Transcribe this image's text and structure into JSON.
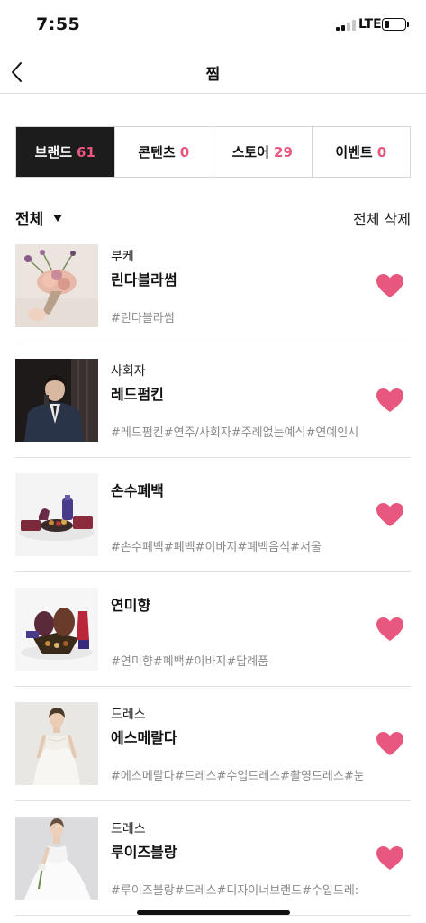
{
  "status_bar": {
    "time": "7:55",
    "network": "LTE"
  },
  "header": {
    "title": "찜"
  },
  "tabs": [
    {
      "label": "브랜드",
      "count": "61",
      "active": true
    },
    {
      "label": "콘텐츠",
      "count": "0",
      "active": false
    },
    {
      "label": "스토어",
      "count": "29",
      "active": false
    },
    {
      "label": "이벤트",
      "count": "0",
      "active": false
    }
  ],
  "filter": {
    "selected": "전체",
    "delete_all": "전체 삭제"
  },
  "items": [
    {
      "category": "부케",
      "name": "린다블라썸",
      "tags": "#린다블라썸",
      "liked": true
    },
    {
      "category": "사회자",
      "name": "레드펌킨",
      "tags": "#레드펌킨#연주/사회자#주례없는예식#연예인시",
      "liked": true
    },
    {
      "category": "",
      "name": "손수폐백",
      "tags": "#손수폐백#폐백#이바지#폐백음식#서울",
      "liked": true
    },
    {
      "category": "",
      "name": "연미향",
      "tags": "#연미향#폐백#이바지#답례품",
      "liked": true
    },
    {
      "category": "드레스",
      "name": "에스메랄다",
      "tags": "#에스메랄다#드레스#수입드레스#촬영드레스#눈",
      "liked": true
    },
    {
      "category": "드레스",
      "name": "루이즈블랑",
      "tags": "#루이즈블랑#드레스#디자이너브랜드#수입드레:",
      "liked": true
    }
  ],
  "colors": {
    "accent": "#e8577e",
    "active_tab_bg": "#1c1c1c",
    "tag_gray": "#8a8a8a"
  },
  "icons": {
    "back": "chevron-left-icon",
    "like": "heart-icon",
    "dropdown": "caret-down-icon"
  }
}
